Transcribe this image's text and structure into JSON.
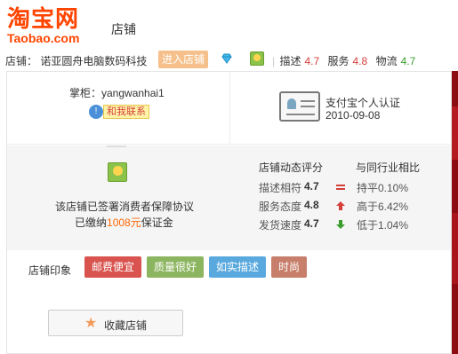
{
  "header": {
    "logo_cn": "淘宝网",
    "logo_en": "Taobao.com",
    "title": "店铺"
  },
  "shopbar": {
    "label": "店铺：  诺亚圆舟电脑数码科技",
    "enter_button": "进入店铺",
    "scores": [
      {
        "label": "描述",
        "value": "4.7"
      },
      {
        "label": "服务",
        "value": "4.8"
      },
      {
        "label": "物流",
        "value": "4.7"
      }
    ]
  },
  "card": {
    "owner": "掌柜：yangwanhai1",
    "contact": "和我联系",
    "auth_title": "支付宝个人认证",
    "auth_date": "2010-09-08",
    "guarantee_line1": "该店铺已签署消费者保障协议",
    "guarantee_line2_prefix": "已缴纳",
    "guarantee_amount": "1008元",
    "guarantee_line2_suffix": "保证金",
    "rating_head": "店铺动态评分",
    "compare_head": "与同行业相比",
    "ratings": [
      {
        "label": "描述相符",
        "score": "4.7",
        "trend": "equal",
        "compare": "持平0.10%",
        "color": "#d43f3a"
      },
      {
        "label": "服务态度",
        "score": "4.8",
        "trend": "up",
        "compare": "高于6.42%",
        "color": "#d43f3a"
      },
      {
        "label": "发货速度",
        "score": "4.7",
        "trend": "down",
        "compare": "低于1.04%",
        "color": "#3c9d2f"
      }
    ],
    "tags_label": "店铺印象",
    "tags": [
      {
        "text": "邮费便宜",
        "color": "#d9534f"
      },
      {
        "text": "质量很好",
        "color": "#8cb560"
      },
      {
        "text": "如实描述",
        "color": "#5aa9de"
      },
      {
        "text": "时尚",
        "color": "#c77e6a"
      }
    ],
    "favorite_button": "收藏店铺"
  }
}
